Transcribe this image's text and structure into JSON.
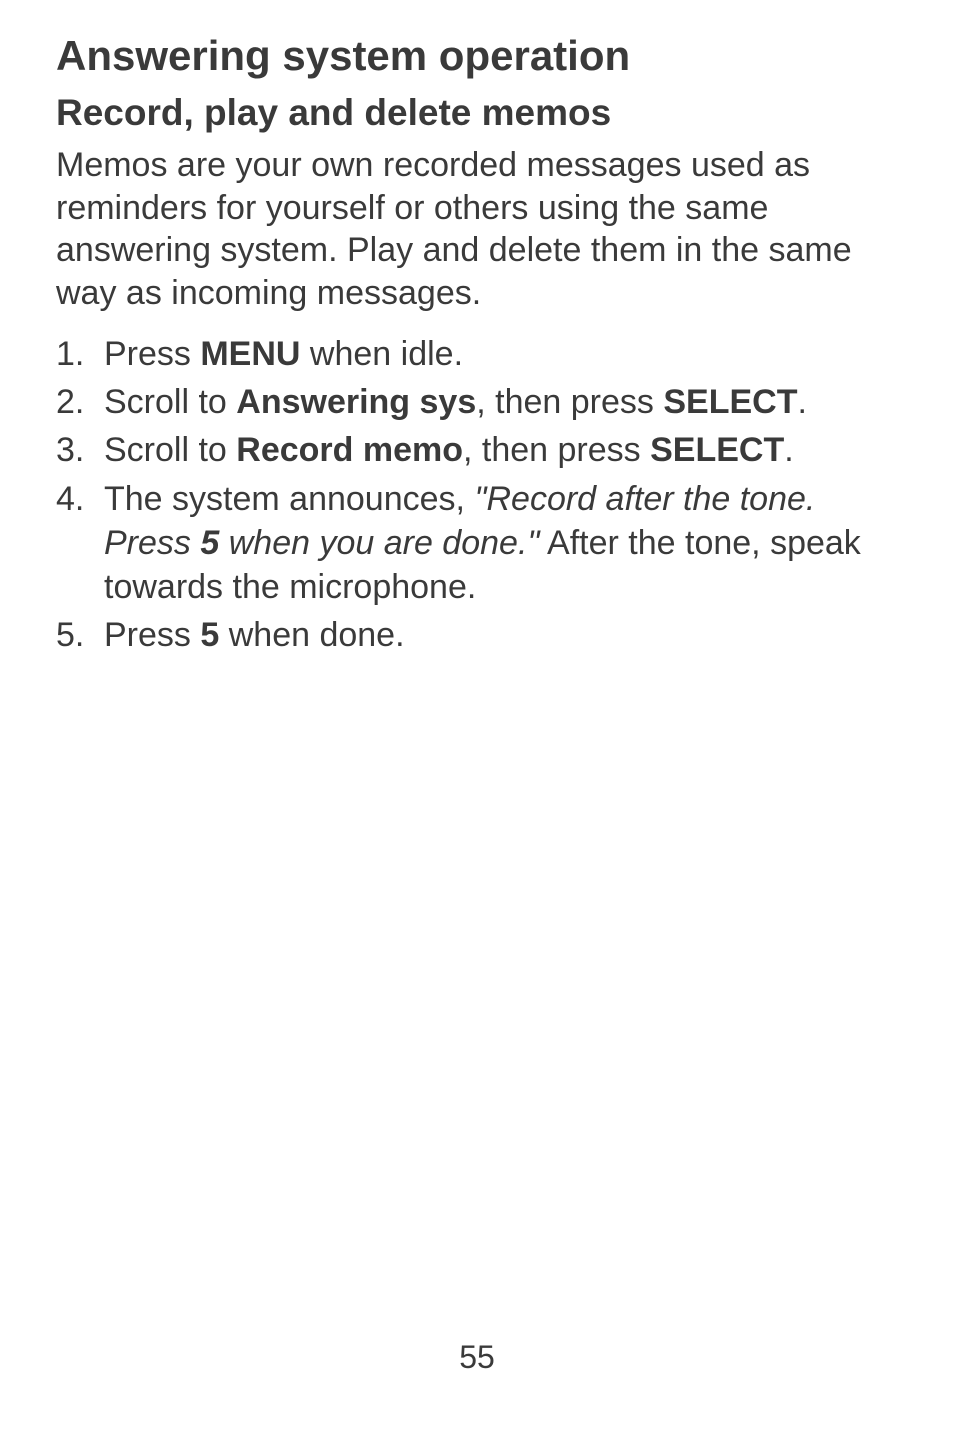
{
  "title": "Answering system operation",
  "subtitle": "Record, play and delete memos",
  "intro": "Memos are your own recorded messages used as reminders for yourself or others using the same answering system. Play and delete them in the same way as incoming messages.",
  "steps": {
    "s1": {
      "pre": "Press ",
      "bold": "MENU",
      "post": " when idle."
    },
    "s2": {
      "pre": "Scroll to ",
      "bold1": "Answering sys",
      "mid": ", then press ",
      "bold2": "SELECT",
      "post": "."
    },
    "s3": {
      "pre": "Scroll to ",
      "bold1": "Record memo",
      "mid": ", then press ",
      "bold2": "SELECT",
      "post": "."
    },
    "s4": {
      "pre": "The system announces, ",
      "italic1": "\"Record after the tone. Press ",
      "bolditalic": "5",
      "italic2": " when you are done.\"",
      "post": " After the tone, speak towards the microphone."
    },
    "s5": {
      "pre": "Press ",
      "bold": "5",
      "post": " when done."
    }
  },
  "pageNumber": "55"
}
